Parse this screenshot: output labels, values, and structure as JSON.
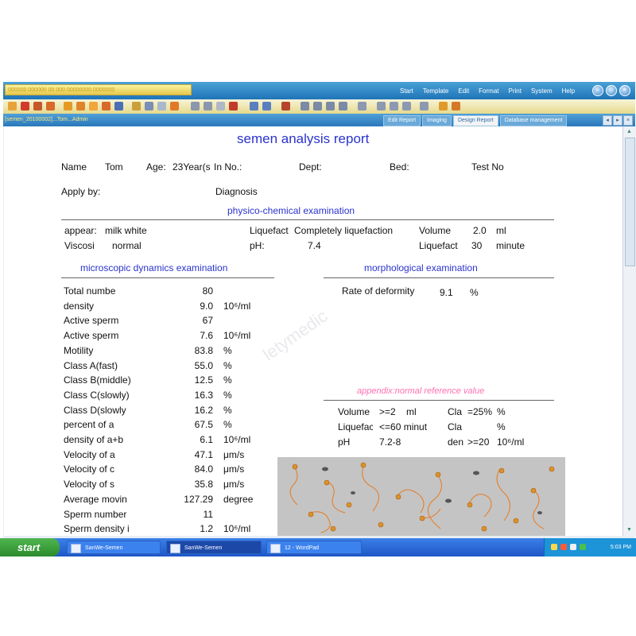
{
  "window": {
    "title": "000000 000000 00 000 00000000 0000000",
    "menu": [
      "Start",
      "Template",
      "Edit",
      "Format",
      "Print",
      "System",
      "Help"
    ],
    "patient_tab": "[semen_20100002]...Tom...Admin",
    "tabs": [
      "Edit Report",
      "Imaging",
      "Design Report",
      "Database management"
    ],
    "active_tab": "Design Report"
  },
  "report": {
    "title": "semen analysis report",
    "header": {
      "name_label": "Name",
      "name_value": "Tom",
      "age_label": "Age:",
      "age_value": "23Year(s",
      "in_no_label": "In No.:",
      "dept_label": "Dept:",
      "bed_label": "Bed:",
      "test_no_label": "Test No",
      "apply_label": "Apply by:",
      "diagnosis_label": "Diagnosis"
    },
    "physico": {
      "title": "physico-chemical examination",
      "appearance_label": "appear:",
      "appearance_value": "milk white",
      "liquefaction_label": "Liquefact",
      "liquefaction_value": "Completely liquefaction",
      "volume_label": "Volume",
      "volume_value": "2.0",
      "volume_unit": "ml",
      "viscosity_label": "Viscosi",
      "viscosity_value": "normal",
      "ph_label": "pH:",
      "ph_value": "7.4",
      "liq_time_label": "Liquefact",
      "liq_time_value": "30",
      "liq_time_unit": "minute"
    },
    "microscopic": {
      "title": "microscopic dynamics examination",
      "rows": [
        {
          "label": "Total numbe",
          "value": "80",
          "unit": ""
        },
        {
          "label": "density",
          "value": "9.0",
          "unit": "10⁶/ml"
        },
        {
          "label": "Active sperm",
          "value": "67",
          "unit": ""
        },
        {
          "label": "Active sperm",
          "value": "7.6",
          "unit": "10⁶/ml"
        },
        {
          "label": "Motility",
          "value": "83.8",
          "unit": "%"
        },
        {
          "label": "Class A(fast)",
          "value": "55.0",
          "unit": "%"
        },
        {
          "label": "Class B(middle)",
          "value": "12.5",
          "unit": "%"
        },
        {
          "label": "Class C(slowly)",
          "value": "16.3",
          "unit": "%"
        },
        {
          "label": "Class D(slowly",
          "value": "16.2",
          "unit": "%"
        },
        {
          "label": "percent of a",
          "value": "67.5",
          "unit": "%"
        },
        {
          "label": "density of a+b",
          "value": "6.1",
          "unit": "10⁶/ml"
        },
        {
          "label": "Velocity of a",
          "value": "47.1",
          "unit": "μm/s"
        },
        {
          "label": "Velocity of c",
          "value": "84.0",
          "unit": "μm/s"
        },
        {
          "label": "Velocity of s",
          "value": "35.8",
          "unit": "μm/s"
        },
        {
          "label": "Average movin",
          "value": "127.29",
          "unit": "degree"
        },
        {
          "label": "Sperm number",
          "value": "11",
          "unit": ""
        },
        {
          "label": "Sperm density i",
          "value": "1.2",
          "unit": "10⁶/ml"
        }
      ]
    },
    "morphological": {
      "title": "morphological examination",
      "deformity_label": "Rate of deformity",
      "deformity_value": "9.1",
      "deformity_unit": "%"
    },
    "appendix": {
      "title": "appendix:normal reference value",
      "rows": [
        {
          "a_label": "Volume",
          "a_value": ">=2",
          "a_unit": "ml",
          "b_label": "Cla",
          "b_value": "=25%",
          "b_unit": "%"
        },
        {
          "a_label": "Liquefac",
          "a_value": "<=60 minut",
          "a_unit": "",
          "b_label": "Cla",
          "b_value": "",
          "b_unit": "%"
        },
        {
          "a_label": "pH",
          "a_value": "7.2-8",
          "a_unit": "",
          "b_label": "den",
          "b_value": ">=20",
          "b_unit": "10⁶/ml"
        }
      ]
    },
    "watermark": "letymedic"
  },
  "taskbar": {
    "start_label": "start",
    "tasks": [
      "SanWe-Semen",
      "SanWe-Semen",
      "12 - WordPad"
    ],
    "clock": "5:03 PM"
  },
  "colors": {
    "heading_blue": "#2a33cc",
    "appendix_pink": "#ff6fb0",
    "taskbar_blue": "#1f56c8",
    "start_green": "#3aa03a"
  }
}
